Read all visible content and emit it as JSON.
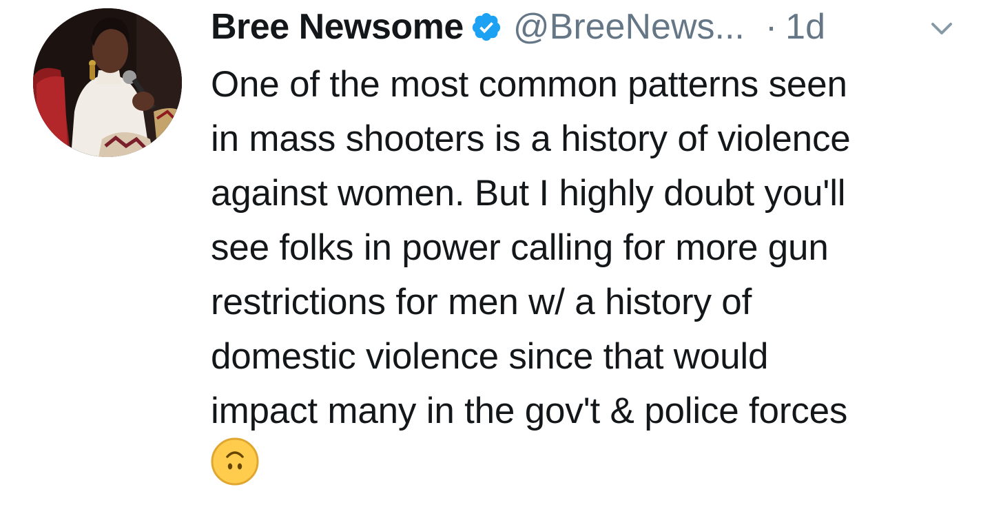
{
  "tweet": {
    "author": {
      "display_name": "Bree Newsome",
      "handle": "@BreeNews...",
      "verified": true,
      "avatar_icon": "profile-photo"
    },
    "separator": "·",
    "timestamp": "1d",
    "text": "One of the most common patterns seen\nin mass shooters is a history of violence\nagainst women. But I highly doubt you'll\nsee folks in power calling for more gun\nrestrictions for men w/ a history of\ndomestic violence since that would\nimpact many in the gov't & police forces",
    "emoji": "upside-down-face",
    "menu_icon": "chevron-down-icon"
  },
  "colors": {
    "primary_text": "#14171a",
    "secondary_text": "#657786",
    "verified_blue": "#1da1f2",
    "background": "#ffffff",
    "emoji_yellow": "#ffcc4d"
  }
}
